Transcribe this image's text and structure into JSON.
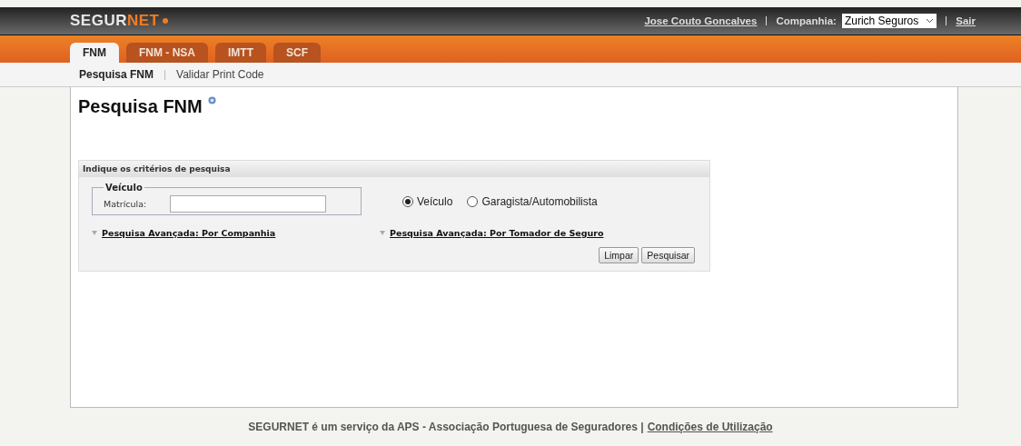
{
  "logo": {
    "part1": "SEGUR",
    "part2": "NET"
  },
  "user": {
    "name": "Jose Couto Goncalves",
    "company_label": "Companhia:",
    "company": "Zurich Seguros",
    "logout": "Sair"
  },
  "tabs": [
    {
      "label": "FNM",
      "selected": true
    },
    {
      "label": "FNM - NSA",
      "selected": false
    },
    {
      "label": "IMTT",
      "selected": false
    },
    {
      "label": "SCF",
      "selected": false
    }
  ],
  "subnav": [
    {
      "label": "Pesquisa FNM",
      "selected": true
    },
    {
      "label": "Validar Print Code",
      "selected": false
    }
  ],
  "page_title": "Pesquisa FNM",
  "search_panel": {
    "header": "Indique os critérios de pesquisa",
    "fieldset": "Veículo",
    "field_label": "Matrícula:",
    "options": [
      {
        "label": "Veículo",
        "selected": true
      },
      {
        "label": "Garagista/Automobilista",
        "selected": false
      }
    ],
    "advanced": [
      "Pesquisa Avançada: Por Companhia",
      "Pesquisa Avançada: Por Tomador de Seguro"
    ],
    "buttons": [
      "Limpar",
      "Pesquisar"
    ]
  },
  "footer": {
    "text": "SEGURNET é um serviço da APS - Associação Portuguesa de Seguradores |",
    "link": "Condições de Utilização"
  }
}
